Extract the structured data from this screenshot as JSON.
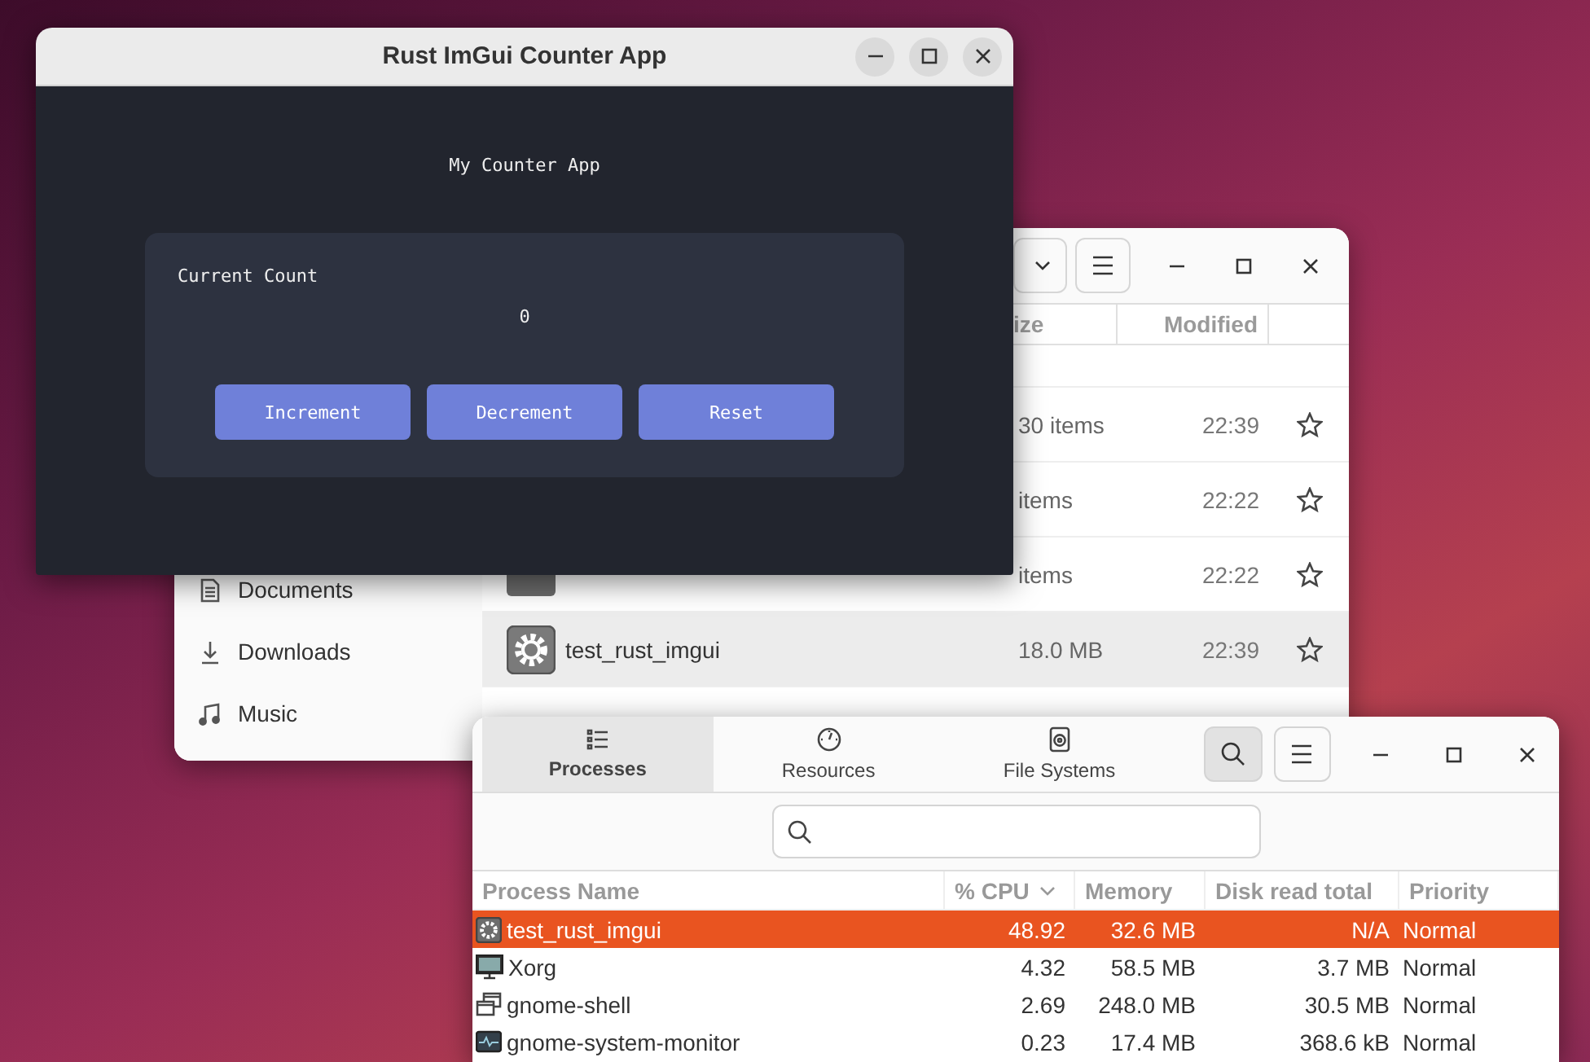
{
  "counter_window": {
    "title": "Rust ImGui Counter App",
    "heading": "My Counter App",
    "count_label": "Current Count",
    "count": "0",
    "buttons": [
      "Increment",
      "Decrement",
      "Reset"
    ]
  },
  "files_window": {
    "sidebar": {
      "items": [
        {
          "label": "Documents",
          "kind": "document"
        },
        {
          "label": "Downloads",
          "kind": "download"
        },
        {
          "label": "Music",
          "kind": "music"
        }
      ]
    },
    "columns": [
      "ize",
      "Modified"
    ],
    "rows": [
      {
        "size": "30 items",
        "modified": "22:39",
        "selected": false
      },
      {
        "size": "items",
        "modified": "22:22",
        "selected": false
      },
      {
        "kind": "folder",
        "size": "items",
        "modified": "22:22",
        "selected": false
      },
      {
        "kind": "executable",
        "name": "test_rust_imgui",
        "size": "18.0 MB",
        "modified": "22:39",
        "selected": true
      }
    ]
  },
  "monitor_window": {
    "tabs": [
      {
        "label": "Processes",
        "kind": "list",
        "selected": true
      },
      {
        "label": "Resources",
        "kind": "gauge",
        "selected": false
      },
      {
        "label": "File Systems",
        "kind": "disk",
        "selected": false
      }
    ],
    "search_active": true,
    "columns": [
      {
        "label": "Process Name",
        "sorted": false
      },
      {
        "label": "% CPU",
        "sorted": true
      },
      {
        "label": "Memory",
        "sorted": false
      },
      {
        "label": "Disk read total",
        "sorted": false
      },
      {
        "label": "Priority",
        "sorted": false
      }
    ],
    "rows": [
      {
        "kind": "gear",
        "name": "test_rust_imgui",
        "cpu": "48.92",
        "memory": "32.6 MB",
        "disk": "N/A",
        "priority": "Normal",
        "selected": true
      },
      {
        "kind": "display",
        "name": "Xorg",
        "cpu": "4.32",
        "memory": "58.5 MB",
        "disk": "3.7 MB",
        "priority": "Normal",
        "selected": false
      },
      {
        "kind": "windows",
        "name": "gnome-shell",
        "cpu": "2.69",
        "memory": "248.0 MB",
        "disk": "30.5 MB",
        "priority": "Normal",
        "selected": false
      },
      {
        "kind": "pulse",
        "name": "gnome-system-monitor",
        "cpu": "0.23",
        "memory": "17.4 MB",
        "disk": "368.6 kB",
        "priority": "Normal",
        "selected": false
      }
    ]
  }
}
